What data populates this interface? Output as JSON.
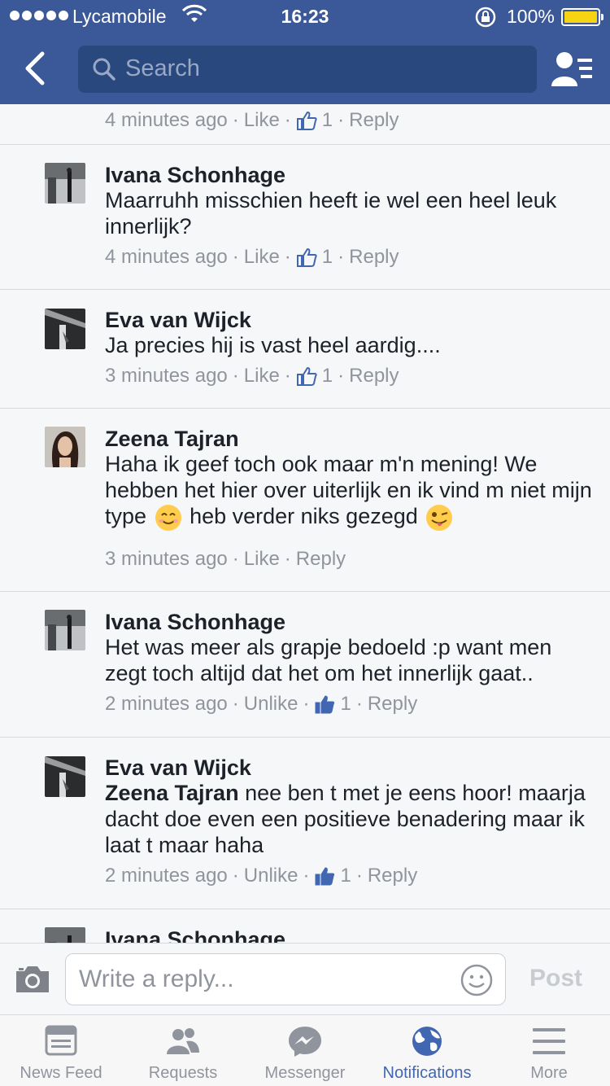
{
  "status_bar": {
    "carrier": "Lycamobile",
    "time": "16:23",
    "battery_percent": "100%",
    "battery_level": 1.0,
    "battery_color": "#f6d313"
  },
  "header": {
    "back_icon": "chevron-left-icon",
    "search_placeholder": "Search",
    "friends_icon": "friends-list-icon",
    "background_color": "#3b5998"
  },
  "comments": [
    {
      "partial": true,
      "meta_time": "4 minutes ago",
      "like_label": "Like",
      "like_count": "1",
      "reply_label": "Reply"
    },
    {
      "author": "Ivana Schonhage",
      "text": "Maarruhh misschien heeft ie wel een heel leuk innerlijk?",
      "meta_time": "4 minutes ago",
      "like_label": "Like",
      "like_count": "1",
      "reply_label": "Reply"
    },
    {
      "author": "Eva van Wijck",
      "text": "Ja precies hij is vast heel aardig....",
      "meta_time": "3 minutes ago",
      "like_label": "Like",
      "like_count": "1",
      "reply_label": "Reply"
    },
    {
      "author": "Zeena Tajran",
      "text_part1": "Haha ik geef toch ook maar m'n mening! We hebben het hier over uiterlijk en ik vind m niet mijn type",
      "text_part2": "heb verder niks gezegd",
      "meta_time": "3 minutes ago",
      "like_label": "Like",
      "reply_label": "Reply"
    },
    {
      "author": "Ivana Schonhage",
      "text": "Het was meer als grapje bedoeld :p want men zegt toch altijd dat het om het innerlijk gaat..",
      "meta_time": "2 minutes ago",
      "like_label": "Unlike",
      "like_count": "1",
      "reply_label": "Reply"
    },
    {
      "author": "Eva van Wijck",
      "mention": "Zeena Tajran",
      "text": "nee ben t met je eens hoor! maarja dacht doe even een positieve benadering maar ik laat t maar haha",
      "meta_time": "2 minutes ago",
      "like_label": "Unlike",
      "like_count": "1",
      "reply_label": "Reply"
    },
    {
      "partial": true,
      "author": "Ivana Schonhage"
    }
  ],
  "reply_bar": {
    "camera_icon": "camera-icon",
    "placeholder": "Write a reply...",
    "emoji_icon": "smiley-icon",
    "post_label": "Post"
  },
  "tabs": [
    {
      "label": "News Feed",
      "icon": "news-feed-icon",
      "active": false
    },
    {
      "label": "Requests",
      "icon": "friend-requests-icon",
      "active": false
    },
    {
      "label": "Messenger",
      "icon": "messenger-icon",
      "active": false
    },
    {
      "label": "Notifications",
      "icon": "globe-icon",
      "active": true
    },
    {
      "label": "More",
      "icon": "menu-icon",
      "active": false
    }
  ],
  "colors": {
    "brand": "#3b5998",
    "active_tab": "#4267b2",
    "meta_text": "#90949c",
    "liked_thumb": "#4267b2"
  }
}
